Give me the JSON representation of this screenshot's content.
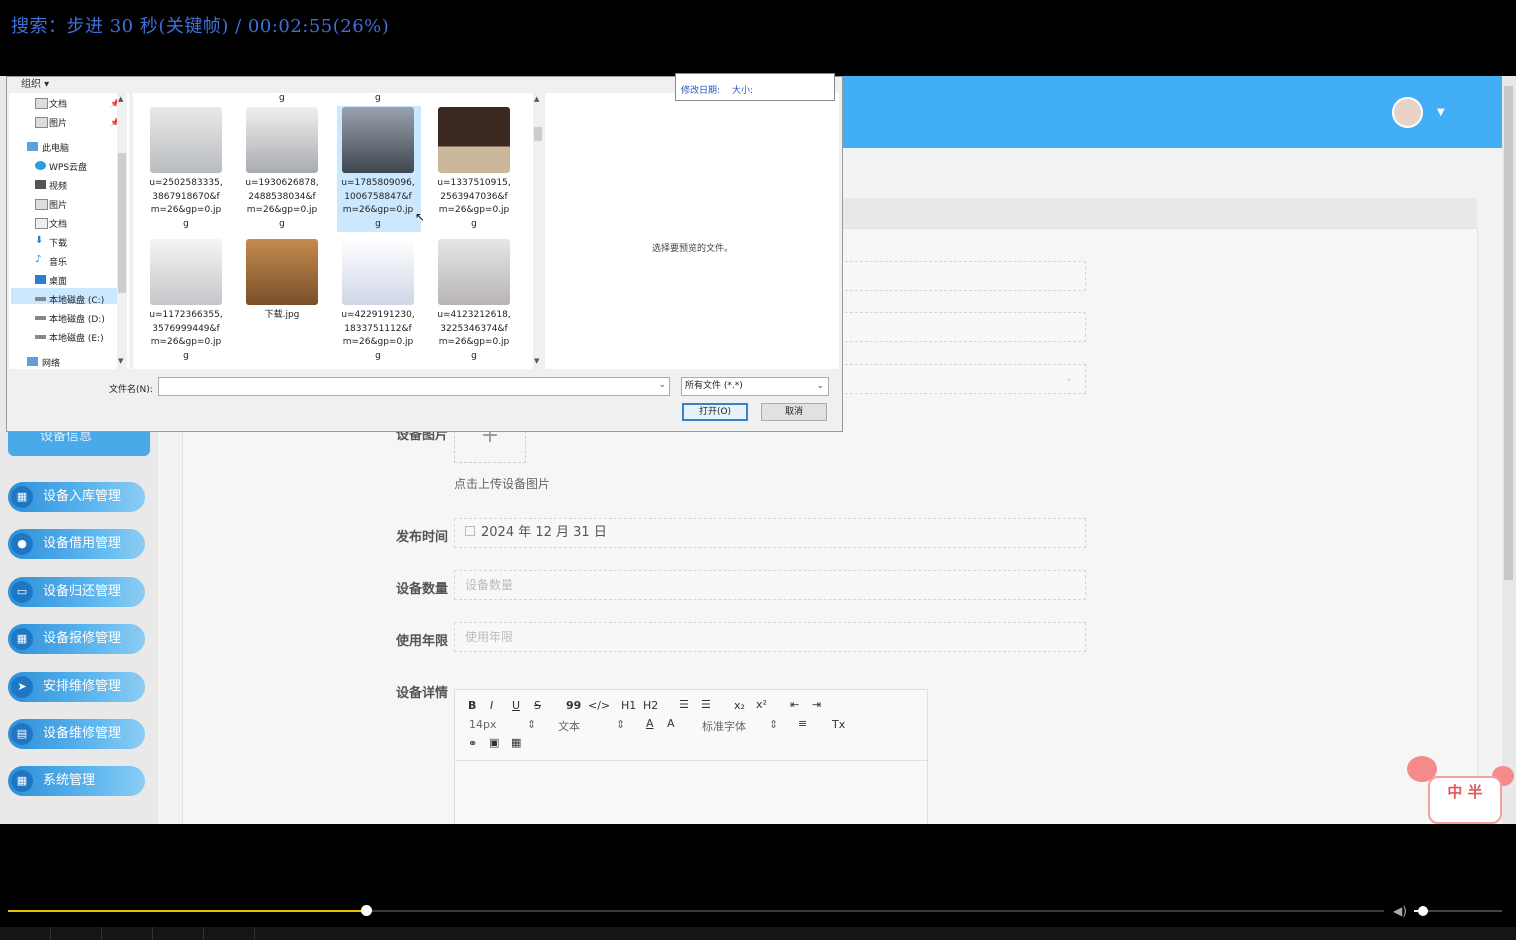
{
  "osd": {
    "text": "搜索：步进 30 秒(关键帧) / 00:02:55(26%)"
  },
  "progress": {
    "fraction": 0.26
  },
  "volume": {
    "fraction": 0.1
  },
  "app": {
    "sidebar_current": "设备信息",
    "menu": [
      {
        "label": "设备入库管理",
        "icon": "grid-icon"
      },
      {
        "label": "设备借用管理",
        "icon": "bulb-icon"
      },
      {
        "label": "设备归还管理",
        "icon": "monitor-icon"
      },
      {
        "label": "设备报修管理",
        "icon": "grid-icon"
      },
      {
        "label": "安排维修管理",
        "icon": "send-icon"
      },
      {
        "label": "设备维修管理",
        "icon": "clipboard-icon"
      },
      {
        "label": "系统管理",
        "icon": "grid-icon"
      }
    ],
    "form": {
      "image_label": "设备图片",
      "upload_plus": "+",
      "upload_hint": "点击上传设备图片",
      "publish_label": "发布时间",
      "publish_value": "2024 年 12 月 31 日",
      "qty_label": "设备数量",
      "qty_placeholder": "设备数量",
      "life_label": "使用年限",
      "life_placeholder": "使用年限",
      "detail_label": "设备详情"
    },
    "editor": {
      "bold": "B",
      "italic": "I",
      "underline": "U",
      "strike": "S",
      "quote": "99",
      "code": "</>",
      "h1": "H1",
      "h2": "H2",
      "sub": "x₂",
      "sup": "x²",
      "font_size": "14px",
      "text_style": "文本",
      "font_family": "标准字体",
      "color": "A",
      "bg": "A",
      "clear": "Tx"
    },
    "mascot_text": "中 半"
  },
  "dialog": {
    "organize": "组织 ▾",
    "nav": [
      {
        "label": "文档"
      },
      {
        "label": "图片"
      },
      {
        "label": "此电脑"
      },
      {
        "label": "WPS云盘"
      },
      {
        "label": "视频"
      },
      {
        "label": "图片"
      },
      {
        "label": "文档"
      },
      {
        "label": "下载"
      },
      {
        "label": "音乐"
      },
      {
        "label": "桌面"
      },
      {
        "label": "本地磁盘 (C:)"
      },
      {
        "label": "本地磁盘 (D:)"
      },
      {
        "label": "本地磁盘 (E:)"
      },
      {
        "label": "网络"
      }
    ],
    "top_fragments": [
      "g",
      "g"
    ],
    "files": [
      {
        "lines": [
          "u=2502583335,",
          "3867918670&f",
          "m=26&gp=0.jp",
          "g"
        ]
      },
      {
        "lines": [
          "u=1930626878,",
          "2488538034&f",
          "m=26&gp=0.jp",
          "g"
        ]
      },
      {
        "lines": [
          "u=1785809096,",
          "1006758847&f",
          "m=26&gp=0.jp",
          "g"
        ]
      },
      {
        "lines": [
          "u=1337510915,",
          "2563947036&f",
          "m=26&gp=0.jp",
          "g"
        ]
      },
      {
        "lines": [
          "u=1172366355,",
          "3576999449&f",
          "m=26&gp=0.jp",
          "g"
        ]
      },
      {
        "lines": [
          "下载.jpg"
        ]
      },
      {
        "lines": [
          "u=4229191230,",
          "1833751112&f",
          "m=26&gp=0.jp",
          "g"
        ]
      },
      {
        "lines": [
          "u=4123212618,",
          "3225346374&f",
          "m=26&gp=0.jp",
          "g"
        ]
      }
    ],
    "preview_hint": "选择要预览的文件。",
    "tooltip": {
      "modified": "修改日期:",
      "size": "大小:"
    },
    "filename_label": "文件名(N):",
    "filetype": "所有文件 (*.*)",
    "open": "打开(O)",
    "cancel": "取消"
  }
}
